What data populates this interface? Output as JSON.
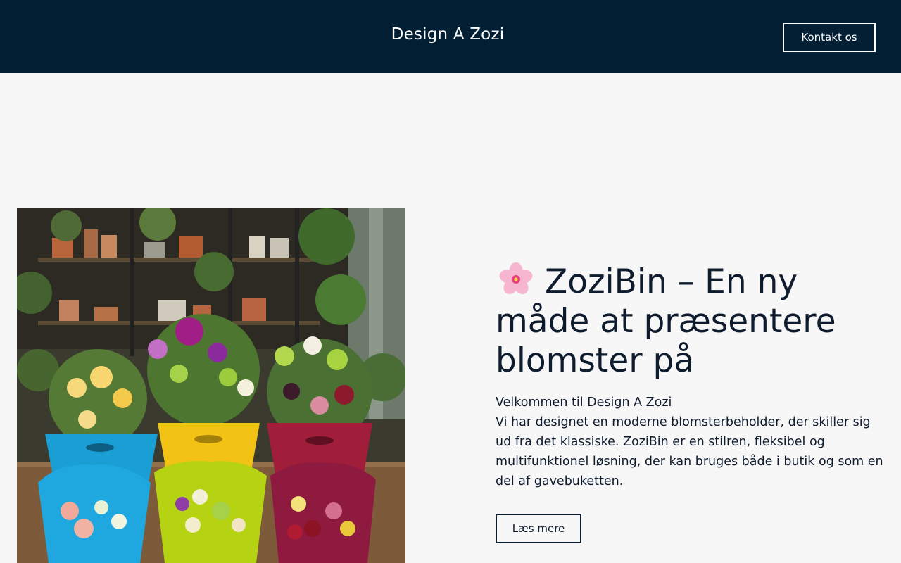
{
  "header": {
    "site_title": "Design A Zozi",
    "contact_label": "Kontakt os",
    "background": "#021f33"
  },
  "hero": {
    "image_alt": "Buketter i farverige ZoziBin beholdere",
    "heading": "ZoziBin – En ny måde at præsentere blomster på",
    "heading_icon": "cherry-blossom-icon",
    "welcome": "Velkommen til Design A Zozi",
    "body": "Vi har designet en moderne blomsterbeholder, der skiller sig ud fra det klassiske. ZoziBin er en stilren, fleksibel og multifunktionel løsning, der kan bruges både i butik og som en del af gavebuketten.",
    "read_more_label": "Læs mere"
  },
  "colors": {
    "page_bg": "#f7f7f7",
    "text": "#0f1c2e",
    "bin_blue": "#1a9fd4",
    "bin_yellow": "#f2c214",
    "bin_red": "#a01e3a",
    "bin_lime": "#b6d313"
  }
}
